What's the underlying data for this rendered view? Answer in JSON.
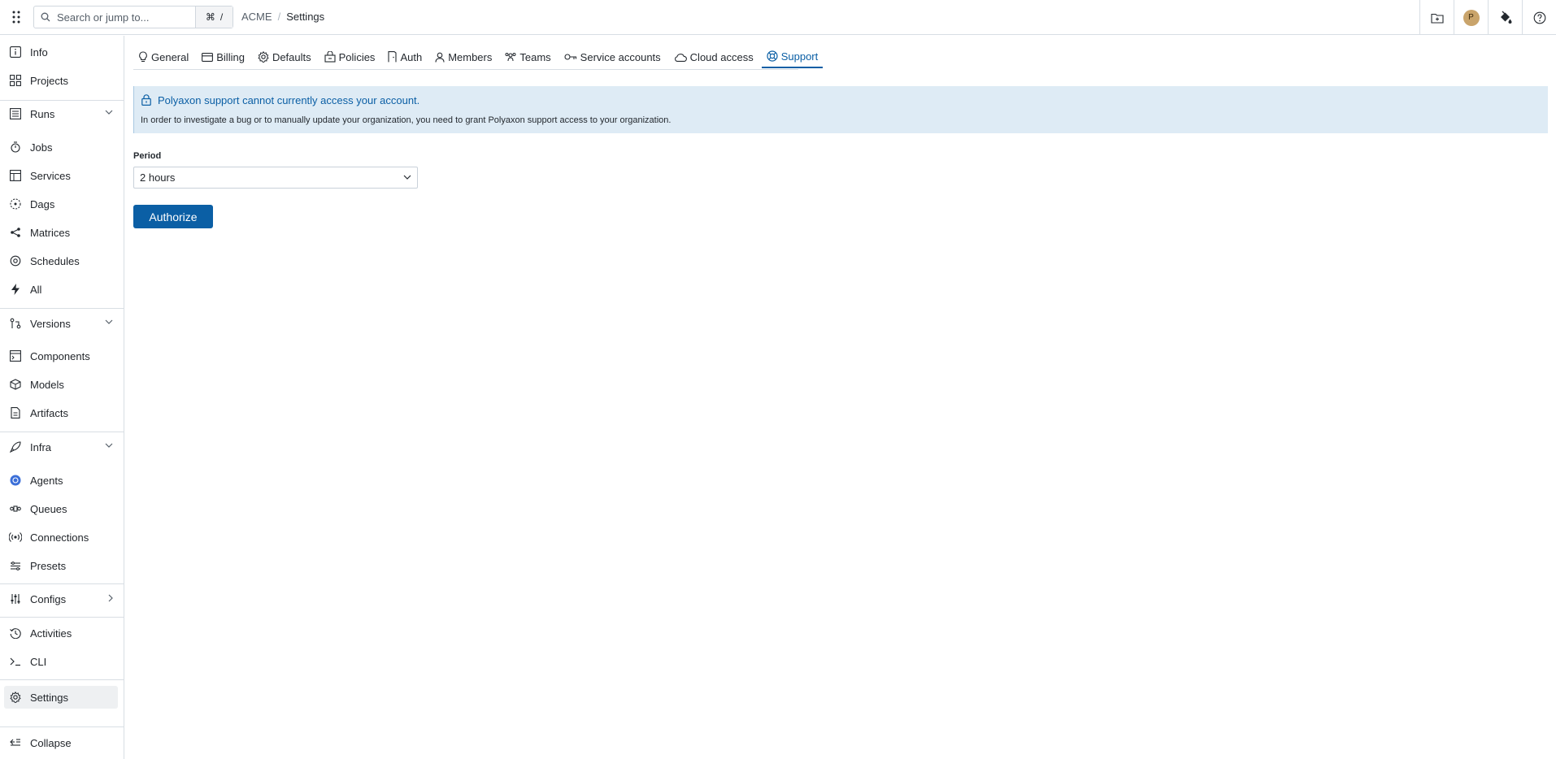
{
  "topbar": {
    "search_placeholder": "Search or jump to...",
    "shortcut_key": "⌘",
    "shortcut_slash": "/",
    "breadcrumb": {
      "org": "ACME",
      "separator": "/",
      "page": "Settings"
    },
    "avatar_initial": "P"
  },
  "sidebar": {
    "info": "Info",
    "projects": "Projects",
    "runs": "Runs",
    "jobs": "Jobs",
    "services": "Services",
    "dags": "Dags",
    "matrices": "Matrices",
    "schedules": "Schedules",
    "all": "All",
    "versions": "Versions",
    "components": "Components",
    "models": "Models",
    "artifacts": "Artifacts",
    "infra": "Infra",
    "agents": "Agents",
    "queues": "Queues",
    "connections": "Connections",
    "presets": "Presets",
    "configs": "Configs",
    "activities": "Activities",
    "cli": "CLI",
    "settings": "Settings",
    "collapse": "Collapse"
  },
  "tabs": {
    "general": "General",
    "billing": "Billing",
    "defaults": "Defaults",
    "policies": "Policies",
    "auth": "Auth",
    "members": "Members",
    "teams": "Teams",
    "service_accounts": "Service accounts",
    "cloud_access": "Cloud access",
    "support": "Support",
    "active": "support"
  },
  "notice": {
    "title": "Polyaxon support cannot currently access your account.",
    "body": "In order to investigate a bug or to manually update your organization, you need to grant Polyaxon support access to your organization."
  },
  "form": {
    "period_label": "Period",
    "period_value": "2 hours",
    "authorize_label": "Authorize"
  },
  "colors": {
    "accent": "#0b5fa5",
    "notice_bg": "#deebf5",
    "active_nav_bg": "#eef0f2"
  }
}
